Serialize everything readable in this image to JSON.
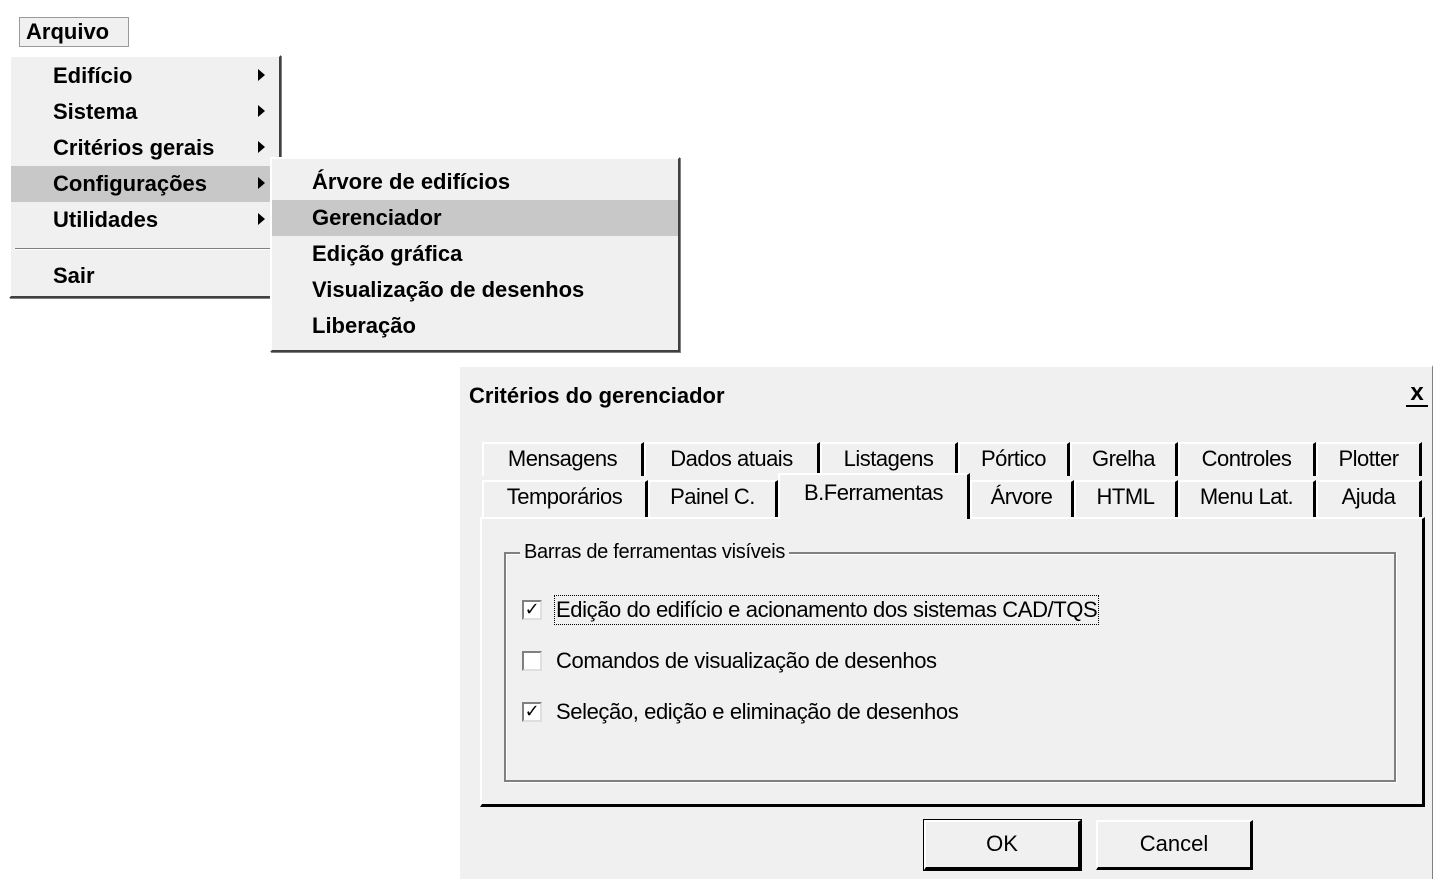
{
  "menubar": {
    "file_label": "Arquivo"
  },
  "main_menu": {
    "items": [
      {
        "label": "Edifício"
      },
      {
        "label": "Sistema"
      },
      {
        "label": "Critérios gerais"
      },
      {
        "label": "Configurações"
      },
      {
        "label": "Utilidades"
      }
    ],
    "exit_label": "Sair"
  },
  "sub_menu": {
    "items": [
      {
        "label": "Árvore de edifícios"
      },
      {
        "label": "Gerenciador"
      },
      {
        "label": "Edição gráfica"
      },
      {
        "label": "Visualização de desenhos"
      },
      {
        "label": "Liberação"
      }
    ]
  },
  "dialog": {
    "title": "Critérios do gerenciador",
    "close_glyph": "x",
    "tabs_row1": [
      "Mensagens",
      "Dados atuais",
      "Listagens",
      "Pórtico",
      "Grelha",
      "Controles",
      "Plotter"
    ],
    "tabs_row2": [
      "Temporários",
      "Painel C.",
      "B.Ferramentas",
      "Árvore",
      "HTML",
      "Menu Lat.",
      "Ajuda"
    ],
    "active_tab": "B.Ferramentas",
    "group_title": "Barras de ferramentas visíveis",
    "options": [
      {
        "label": "Edição do edifício e acionamento dos sistemas CAD/TQS",
        "checked": true
      },
      {
        "label": "Comandos de visualização de desenhos",
        "checked": false
      },
      {
        "label": "Seleção, edição e eliminação de desenhos",
        "checked": true
      }
    ],
    "ok_label": "OK",
    "cancel_label": "Cancel"
  },
  "colors": {
    "face": "#f0f0f0",
    "highlight": "#c8c8c8"
  }
}
